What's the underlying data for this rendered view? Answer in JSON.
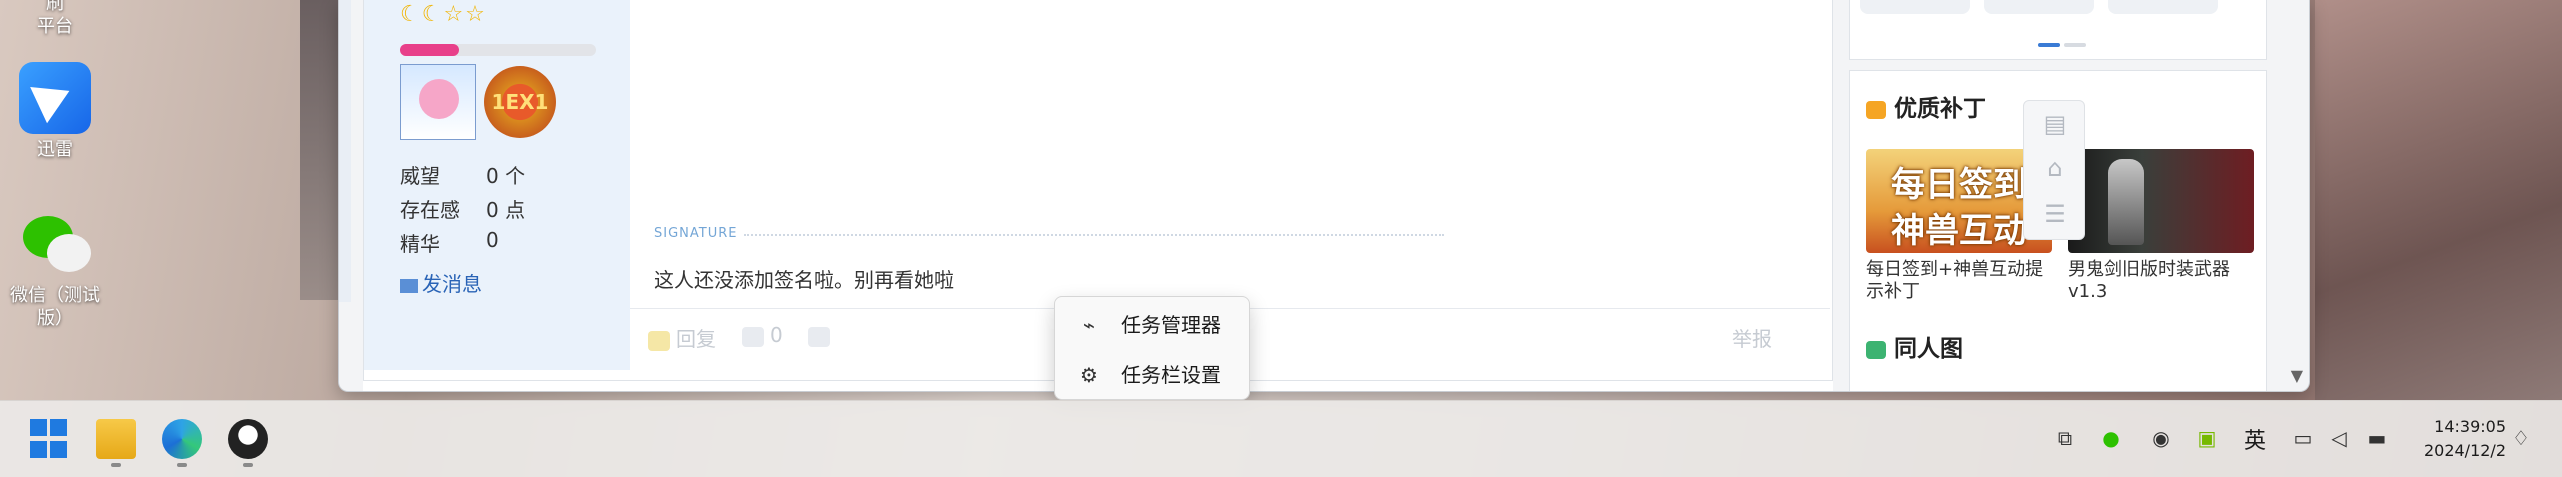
{
  "desktop": {
    "icon_top_partial_label": "刷",
    "icon_top_partial_label2": "平台",
    "icons": [
      {
        "label": "迅雷"
      },
      {
        "label": "微信（测试版）"
      }
    ]
  },
  "user": {
    "stars": "☾☾☆☆",
    "progress": 0.3,
    "stats": [
      {
        "label": "威望",
        "value": "0 个"
      },
      {
        "label": "存在感",
        "value": "0 点"
      },
      {
        "label": "精华",
        "value": "0"
      }
    ],
    "medal_text": "1EX1",
    "message_link": "发消息"
  },
  "post": {
    "signature_label": "SIGNATURE",
    "signature_text": "这人还没添加签名啦。别再看她啦",
    "reply_label": "回复",
    "like_count": "0",
    "report_label": "举报"
  },
  "sidebar_right": {
    "quality_patch_title": "优质补丁",
    "patches": [
      {
        "thumb_line1": "每日签到",
        "thumb_line2": "神兽互动",
        "caption": "每日签到+神兽互动提示补丁"
      },
      {
        "caption": "男鬼剑旧版时装武器v1.3"
      }
    ],
    "doujin_title": "同人图"
  },
  "context_menu": {
    "items": [
      {
        "label": "任务管理器",
        "icon": "task-manager-icon"
      },
      {
        "label": "任务栏设置",
        "icon": "gear-icon"
      }
    ]
  },
  "taskbar": {
    "ime": "英",
    "time": "14:39:05",
    "date": "2024/12/2"
  },
  "colors": {
    "accent": "#1f7ae0",
    "link": "#2963b6",
    "progress": "#e8408a"
  }
}
